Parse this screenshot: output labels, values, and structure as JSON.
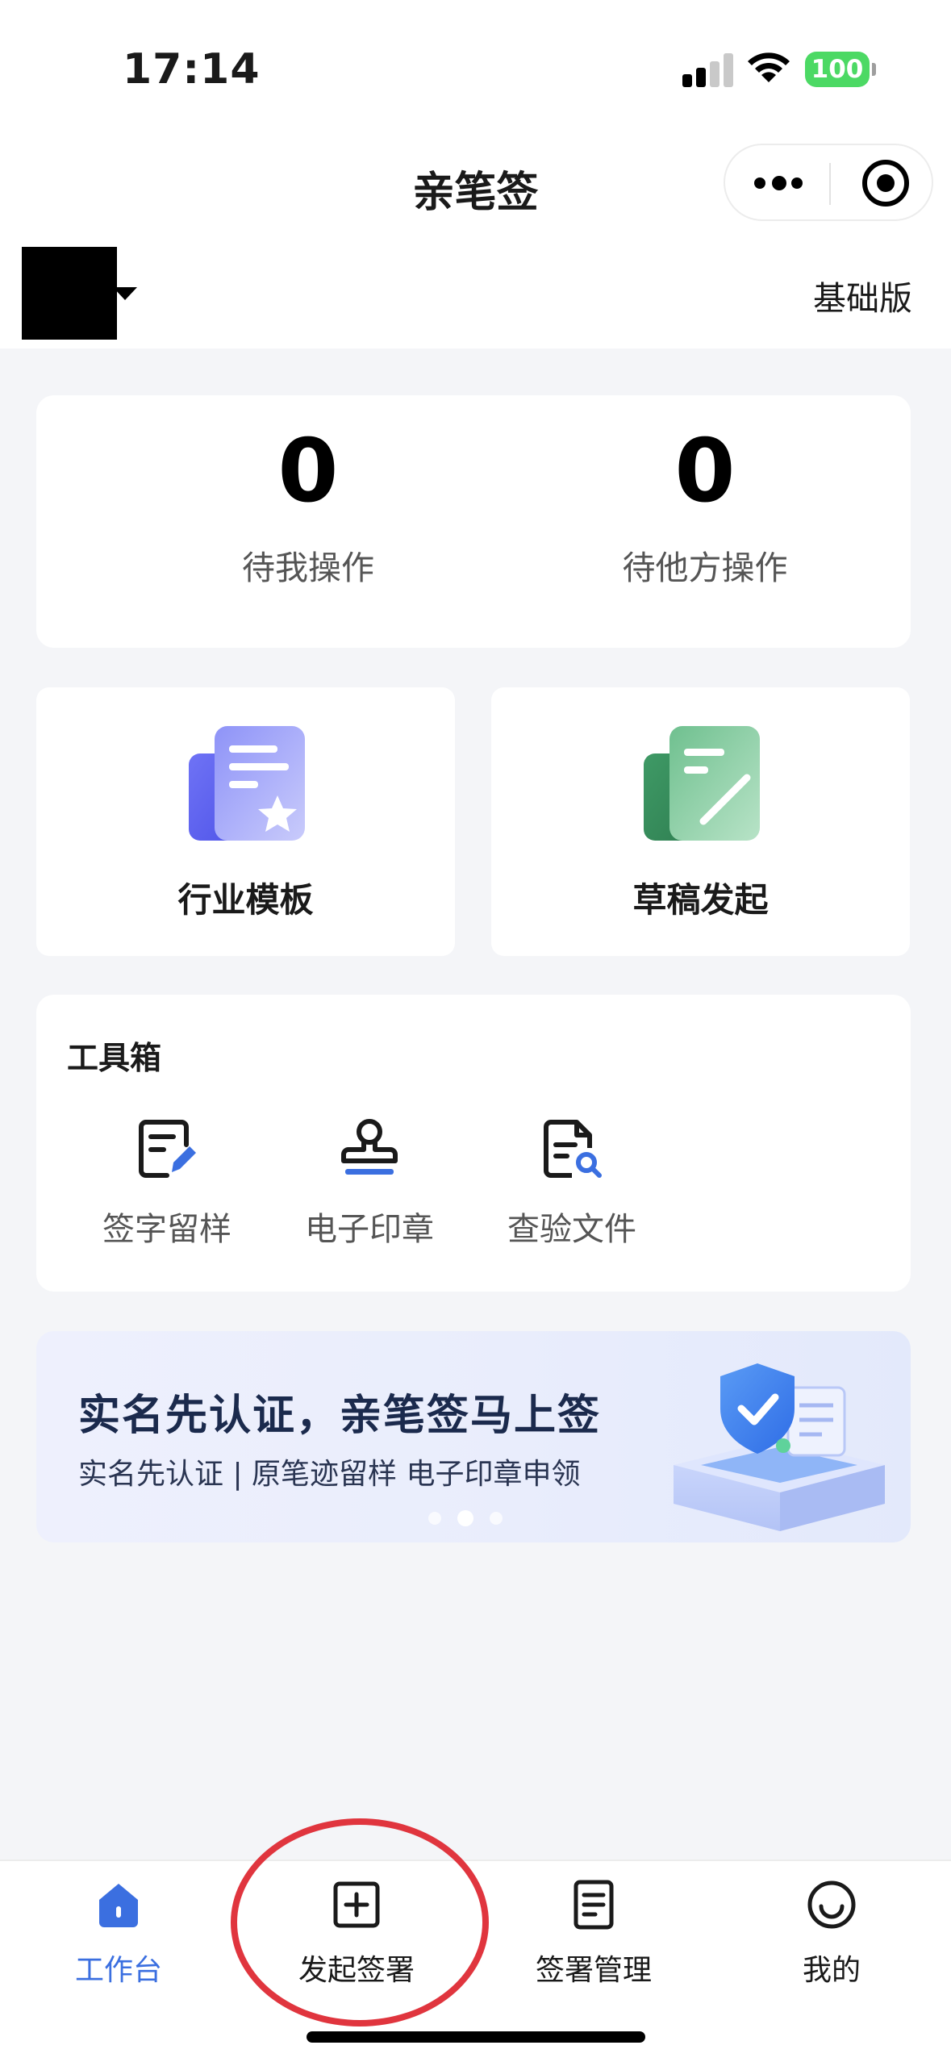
{
  "status_bar": {
    "time": "17:14",
    "battery": "100"
  },
  "nav": {
    "title": "亲笔签"
  },
  "account": {
    "plan": "基础版"
  },
  "stats": [
    {
      "value": "0",
      "label": "待我操作"
    },
    {
      "value": "0",
      "label": "待他方操作"
    }
  ],
  "features": [
    {
      "label": "行业模板",
      "icon": "template-icon"
    },
    {
      "label": "草稿发起",
      "icon": "draft-icon"
    }
  ],
  "toolbox": {
    "title": "工具箱",
    "items": [
      {
        "label": "签字留样",
        "icon": "signature-icon"
      },
      {
        "label": "电子印章",
        "icon": "stamp-icon"
      },
      {
        "label": "查验文件",
        "icon": "verify-file-icon"
      }
    ]
  },
  "banner": {
    "title": "实名先认证，亲笔签马上签",
    "subtitle": "实名先认证 | 原笔迹留样 电子印章申领"
  },
  "tabs": [
    {
      "label": "工作台",
      "icon": "home-icon",
      "active": true
    },
    {
      "label": "发起签署",
      "icon": "plus-square-icon"
    },
    {
      "label": "签署管理",
      "icon": "document-icon"
    },
    {
      "label": "我的",
      "icon": "smile-icon"
    }
  ],
  "colors": {
    "accent": "#3b6fe0",
    "annotation": "#e0353e",
    "background": "#f4f5f8"
  }
}
